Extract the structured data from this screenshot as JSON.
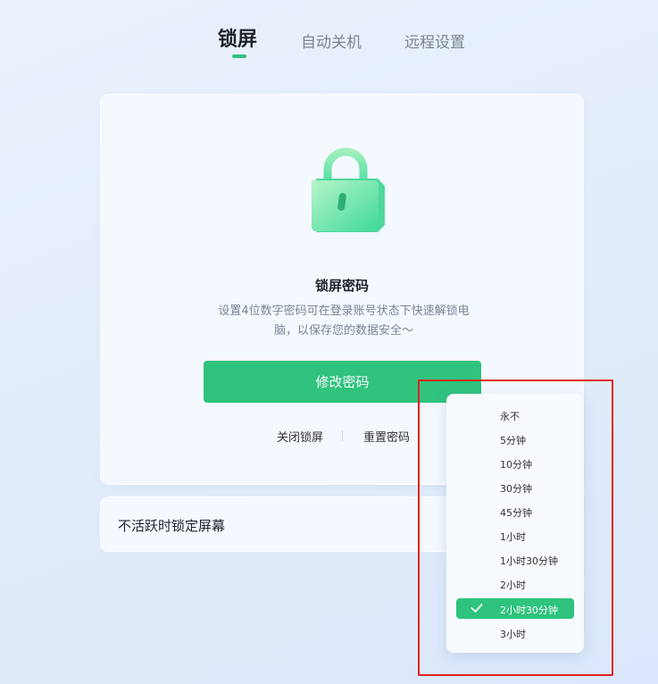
{
  "tabs": [
    {
      "label": "锁屏"
    },
    {
      "label": "自动关机"
    },
    {
      "label": "远程设置"
    }
  ],
  "lock_card": {
    "icon": "lock-icon",
    "title": "锁屏密码",
    "description": "设置4位数字密码可在登录账号状态下快速解锁电脑，以保存您的数据安全～",
    "primary_button": "修改密码",
    "link_close": "关闭锁屏",
    "link_reset": "重置密码"
  },
  "inactivity": {
    "label": "不活跃时锁定屏幕"
  },
  "dropdown": {
    "options": [
      "永不",
      "5分钟",
      "10分钟",
      "30分钟",
      "45分钟",
      "1小时",
      "1小时30分钟",
      "2小时",
      "2小时30分钟",
      "3小时"
    ],
    "selected": "2小时30分钟"
  },
  "colors": {
    "accent": "#2fc37d",
    "highlight_box": "#e1221f"
  }
}
